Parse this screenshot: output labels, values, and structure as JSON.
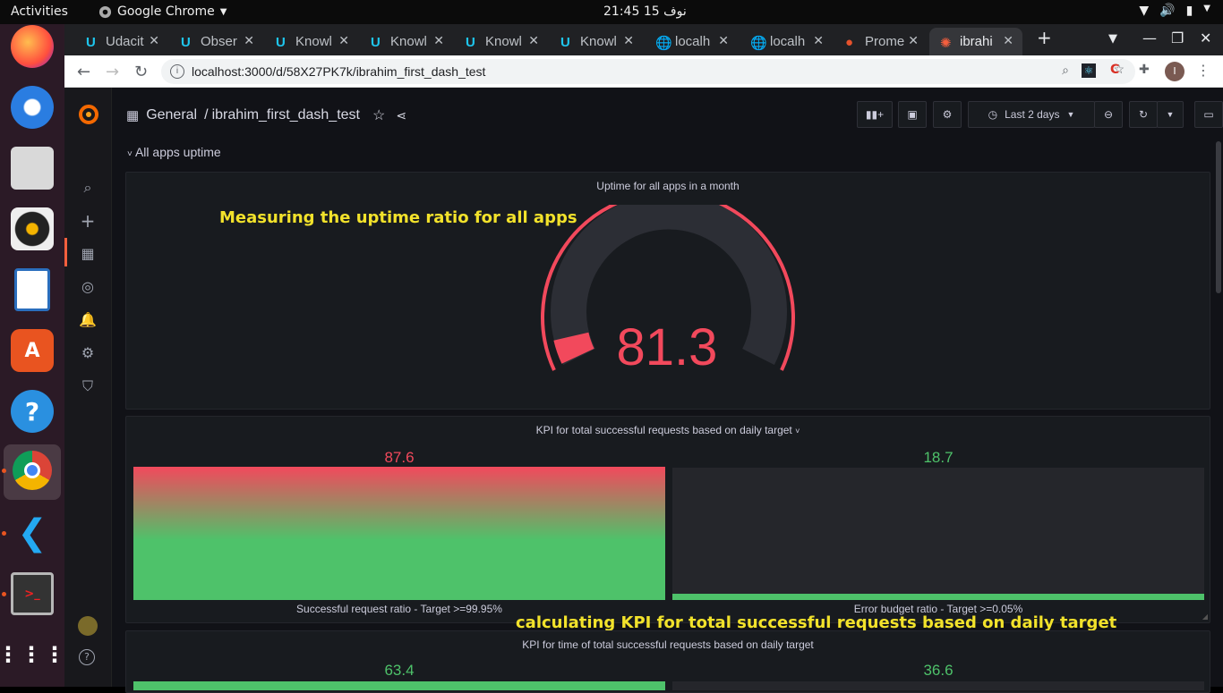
{
  "os_topbar": {
    "activities": "Activities",
    "app_name": "Google Chrome",
    "clock": "نوف 15  21:45"
  },
  "dock": {
    "apps": [
      "Firefox",
      "Thunderbird",
      "Files",
      "Rhythmbox",
      "LibreOffice Writer",
      "Ubuntu Software",
      "Help",
      "Google Chrome",
      "Visual Studio Code",
      "Terminal",
      "Show Applications"
    ]
  },
  "browser": {
    "tabs": [
      {
        "label": "Udacit",
        "icon": "udacity-icon"
      },
      {
        "label": "Obser",
        "icon": "udacity-icon"
      },
      {
        "label": "Knowl",
        "icon": "udacity-icon"
      },
      {
        "label": "Knowl",
        "icon": "udacity-icon"
      },
      {
        "label": "Knowl",
        "icon": "udacity-icon"
      },
      {
        "label": "Knowl",
        "icon": "udacity-icon"
      },
      {
        "label": "localh",
        "icon": "globe-icon"
      },
      {
        "label": "localh",
        "icon": "globe-icon"
      },
      {
        "label": "Prome",
        "icon": "prometheus-icon"
      },
      {
        "label": "ibrahi",
        "icon": "grafana-icon",
        "active": true
      }
    ],
    "url": "localhost:3000/d/58X27PK7k/ibrahim_first_dash_test"
  },
  "grafana": {
    "breadcrumb_folder": "General",
    "breadcrumb_sep": "/",
    "dashboard_title": "ibrahim_first_dash_test",
    "time_range": "Last 2 days",
    "row_title": "All apps uptime",
    "panels": {
      "uptime": {
        "title": "Uptime for all apps in a month",
        "annotation": "Measuring the uptime ratio for all apps",
        "value": "81.3",
        "value_fraction": 0.813
      },
      "kpi_requests": {
        "title": "KPI for total successful requests based on daily target",
        "annotation": "calculating KPI for total successful requests based on daily target",
        "bars": [
          {
            "value": "87.6",
            "label": "Successful request ratio - Target >=99.95%",
            "fraction": 0.876
          },
          {
            "value": "18.7",
            "label": "Error budget ratio - Target >=0.05%",
            "fraction": 0.05
          }
        ]
      },
      "kpi_time": {
        "title": "KPI for time of total successful requests based on daily target",
        "bars": [
          {
            "value": "63.4"
          },
          {
            "value": "36.6"
          }
        ]
      }
    }
  },
  "colors": {
    "red": "#f2495c",
    "green": "#4ec26a",
    "grafana_orange": "#f55f3e"
  }
}
